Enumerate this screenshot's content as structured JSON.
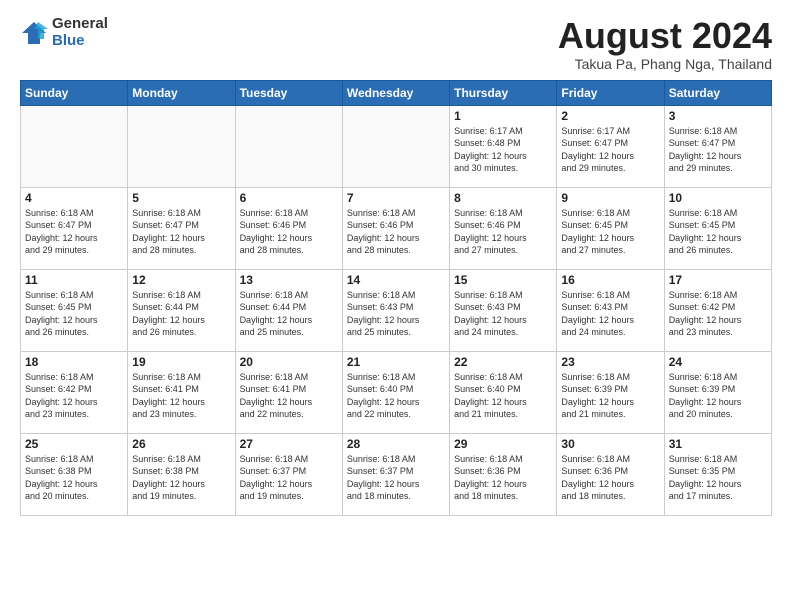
{
  "logo": {
    "general": "General",
    "blue": "Blue"
  },
  "title": "August 2024",
  "subtitle": "Takua Pa, Phang Nga, Thailand",
  "header": {
    "days": [
      "Sunday",
      "Monday",
      "Tuesday",
      "Wednesday",
      "Thursday",
      "Friday",
      "Saturday"
    ]
  },
  "weeks": [
    [
      {
        "num": "",
        "info": ""
      },
      {
        "num": "",
        "info": ""
      },
      {
        "num": "",
        "info": ""
      },
      {
        "num": "",
        "info": ""
      },
      {
        "num": "1",
        "info": "Sunrise: 6:17 AM\nSunset: 6:48 PM\nDaylight: 12 hours\nand 30 minutes."
      },
      {
        "num": "2",
        "info": "Sunrise: 6:17 AM\nSunset: 6:47 PM\nDaylight: 12 hours\nand 29 minutes."
      },
      {
        "num": "3",
        "info": "Sunrise: 6:18 AM\nSunset: 6:47 PM\nDaylight: 12 hours\nand 29 minutes."
      }
    ],
    [
      {
        "num": "4",
        "info": "Sunrise: 6:18 AM\nSunset: 6:47 PM\nDaylight: 12 hours\nand 29 minutes."
      },
      {
        "num": "5",
        "info": "Sunrise: 6:18 AM\nSunset: 6:47 PM\nDaylight: 12 hours\nand 28 minutes."
      },
      {
        "num": "6",
        "info": "Sunrise: 6:18 AM\nSunset: 6:46 PM\nDaylight: 12 hours\nand 28 minutes."
      },
      {
        "num": "7",
        "info": "Sunrise: 6:18 AM\nSunset: 6:46 PM\nDaylight: 12 hours\nand 28 minutes."
      },
      {
        "num": "8",
        "info": "Sunrise: 6:18 AM\nSunset: 6:46 PM\nDaylight: 12 hours\nand 27 minutes."
      },
      {
        "num": "9",
        "info": "Sunrise: 6:18 AM\nSunset: 6:45 PM\nDaylight: 12 hours\nand 27 minutes."
      },
      {
        "num": "10",
        "info": "Sunrise: 6:18 AM\nSunset: 6:45 PM\nDaylight: 12 hours\nand 26 minutes."
      }
    ],
    [
      {
        "num": "11",
        "info": "Sunrise: 6:18 AM\nSunset: 6:45 PM\nDaylight: 12 hours\nand 26 minutes."
      },
      {
        "num": "12",
        "info": "Sunrise: 6:18 AM\nSunset: 6:44 PM\nDaylight: 12 hours\nand 26 minutes."
      },
      {
        "num": "13",
        "info": "Sunrise: 6:18 AM\nSunset: 6:44 PM\nDaylight: 12 hours\nand 25 minutes."
      },
      {
        "num": "14",
        "info": "Sunrise: 6:18 AM\nSunset: 6:43 PM\nDaylight: 12 hours\nand 25 minutes."
      },
      {
        "num": "15",
        "info": "Sunrise: 6:18 AM\nSunset: 6:43 PM\nDaylight: 12 hours\nand 24 minutes."
      },
      {
        "num": "16",
        "info": "Sunrise: 6:18 AM\nSunset: 6:43 PM\nDaylight: 12 hours\nand 24 minutes."
      },
      {
        "num": "17",
        "info": "Sunrise: 6:18 AM\nSunset: 6:42 PM\nDaylight: 12 hours\nand 23 minutes."
      }
    ],
    [
      {
        "num": "18",
        "info": "Sunrise: 6:18 AM\nSunset: 6:42 PM\nDaylight: 12 hours\nand 23 minutes."
      },
      {
        "num": "19",
        "info": "Sunrise: 6:18 AM\nSunset: 6:41 PM\nDaylight: 12 hours\nand 23 minutes."
      },
      {
        "num": "20",
        "info": "Sunrise: 6:18 AM\nSunset: 6:41 PM\nDaylight: 12 hours\nand 22 minutes."
      },
      {
        "num": "21",
        "info": "Sunrise: 6:18 AM\nSunset: 6:40 PM\nDaylight: 12 hours\nand 22 minutes."
      },
      {
        "num": "22",
        "info": "Sunrise: 6:18 AM\nSunset: 6:40 PM\nDaylight: 12 hours\nand 21 minutes."
      },
      {
        "num": "23",
        "info": "Sunrise: 6:18 AM\nSunset: 6:39 PM\nDaylight: 12 hours\nand 21 minutes."
      },
      {
        "num": "24",
        "info": "Sunrise: 6:18 AM\nSunset: 6:39 PM\nDaylight: 12 hours\nand 20 minutes."
      }
    ],
    [
      {
        "num": "25",
        "info": "Sunrise: 6:18 AM\nSunset: 6:38 PM\nDaylight: 12 hours\nand 20 minutes."
      },
      {
        "num": "26",
        "info": "Sunrise: 6:18 AM\nSunset: 6:38 PM\nDaylight: 12 hours\nand 19 minutes."
      },
      {
        "num": "27",
        "info": "Sunrise: 6:18 AM\nSunset: 6:37 PM\nDaylight: 12 hours\nand 19 minutes."
      },
      {
        "num": "28",
        "info": "Sunrise: 6:18 AM\nSunset: 6:37 PM\nDaylight: 12 hours\nand 18 minutes."
      },
      {
        "num": "29",
        "info": "Sunrise: 6:18 AM\nSunset: 6:36 PM\nDaylight: 12 hours\nand 18 minutes."
      },
      {
        "num": "30",
        "info": "Sunrise: 6:18 AM\nSunset: 6:36 PM\nDaylight: 12 hours\nand 18 minutes."
      },
      {
        "num": "31",
        "info": "Sunrise: 6:18 AM\nSunset: 6:35 PM\nDaylight: 12 hours\nand 17 minutes."
      }
    ]
  ]
}
